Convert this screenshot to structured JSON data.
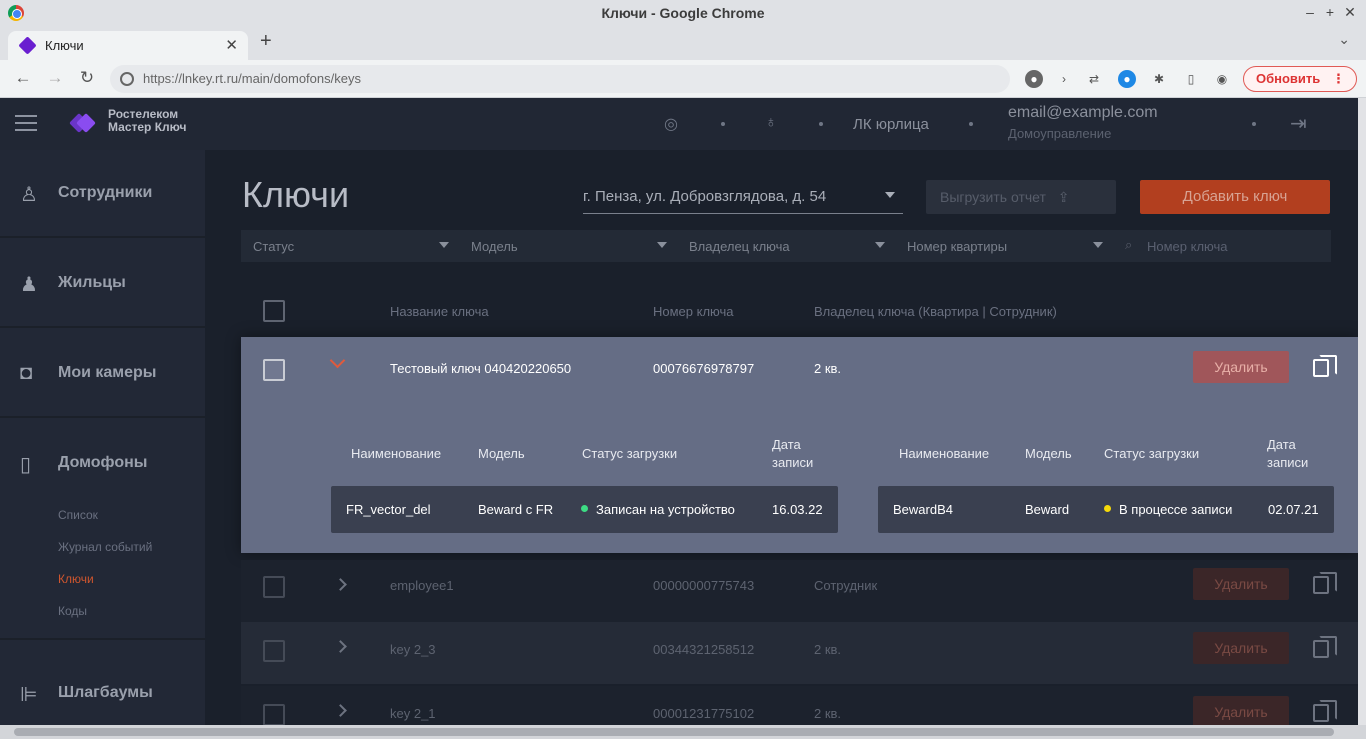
{
  "window": {
    "title": "Ключи - Google Chrome",
    "controls": [
      "–",
      "+",
      "✕"
    ]
  },
  "tab": {
    "label": "Ключи",
    "new_tab": "+"
  },
  "address": {
    "url": "https://lnkey.rt.ru/main/domofons/keys",
    "update_label": "Обновить"
  },
  "app": {
    "brand_line1": "Ростелеком",
    "brand_line2": "Мастер Ключ",
    "header_account_type": "ЛК юрлица",
    "header_email": "email@example.com",
    "header_org": "Домоуправление"
  },
  "sidebar": {
    "items": [
      {
        "label": "Сотрудники",
        "icon": "person-icon"
      },
      {
        "label": "Жильцы",
        "icon": "people-icon"
      },
      {
        "label": "Мои камеры",
        "icon": "camera-icon"
      },
      {
        "label": "Домофоны",
        "icon": "intercom-icon"
      },
      {
        "label": "Шлагбаумы",
        "icon": "barrier-icon"
      }
    ],
    "sub": [
      "Список",
      "Журнал событий",
      "Ключи",
      "Коды"
    ],
    "active_sub": "Ключи"
  },
  "main": {
    "title": "Ключи",
    "address_select": "г. Пенза, ул. Добровзглядова, д. 54",
    "export_label": "Выгрузить отчет",
    "add_label": "Добавить ключ",
    "filters": [
      "Статус",
      "Модель",
      "Владелец ключа",
      "Номер квартиры"
    ],
    "search_placeholder": "Номер ключа",
    "columns": [
      "Название ключа",
      "Номер ключа",
      "Владелец ключа (Квартира | Сотрудник)"
    ],
    "delete_label": "Удалить",
    "expanded_row": {
      "name": "Тестовый ключ 040420220650",
      "number": "00076676978797",
      "owner": "2 кв."
    },
    "device_columns": [
      "Наименование",
      "Модель",
      "Статус загрузки",
      "Дата записи"
    ],
    "devices": [
      {
        "name": "FR_vector_del",
        "model": "Beward с FR",
        "status": "Записан на устройство",
        "status_color": "#3ddc84",
        "date": "16.03.22"
      },
      {
        "name": "BewardB4",
        "model": "Beward",
        "status": "В процессе записи",
        "status_color": "#f5d90a",
        "date": "02.07.21"
      }
    ],
    "rows": [
      {
        "name": "employee1",
        "number": "00000000775743",
        "owner": "Сотрудник"
      },
      {
        "name": "key 2_3",
        "number": "00344321258512",
        "owner": "2 кв."
      },
      {
        "name": "key 2_1",
        "number": "00001231775102",
        "owner": "2 кв."
      }
    ]
  }
}
